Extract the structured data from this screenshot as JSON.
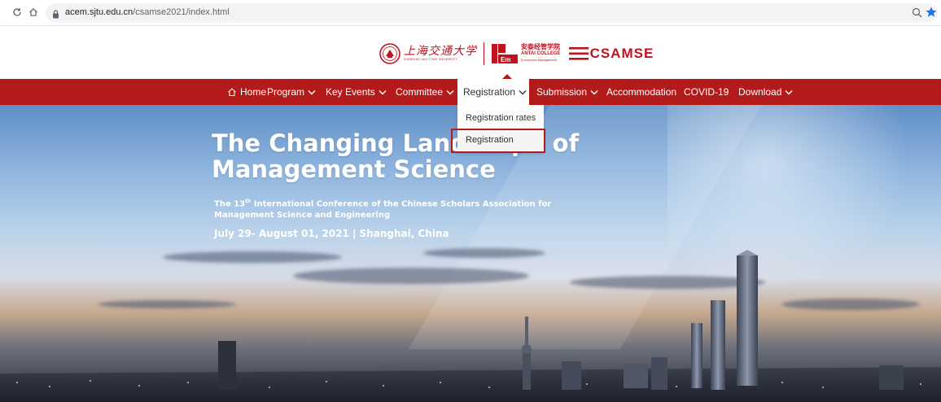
{
  "browser": {
    "url_domain": "acem.sjtu.edu.cn",
    "url_path": "/csamse2021/index.html",
    "icons": [
      "reload-icon",
      "home-icon",
      "lock-icon",
      "zoom-icon",
      "bookmark-star-icon"
    ]
  },
  "header": {
    "sjtu_name_cn": "上海交通大学",
    "sjtu_name_en": "SHANGHAI JIAO TONG UNIVERSITY",
    "acem_name_cn": "安泰经管学院",
    "acem_name_en": "ANTAI COLLEGE",
    "acem_subtitle": "Economics Management",
    "csamse_logo_text": "CSAMSE"
  },
  "nav": {
    "items": [
      {
        "label": "Home",
        "has_dropdown": false
      },
      {
        "label": "Program",
        "has_dropdown": true
      },
      {
        "label": "Key Events",
        "has_dropdown": true
      },
      {
        "label": "Committee",
        "has_dropdown": true
      },
      {
        "label": "Registration",
        "has_dropdown": true,
        "active": true
      },
      {
        "label": "Submission",
        "has_dropdown": true
      },
      {
        "label": "Accommodation",
        "has_dropdown": false
      },
      {
        "label": "COVID-19",
        "has_dropdown": false
      },
      {
        "label": "Download",
        "has_dropdown": true
      }
    ],
    "dropdown": {
      "items": [
        {
          "label": "Registration rates"
        },
        {
          "label": "Registration",
          "highlighted": true
        }
      ]
    }
  },
  "hero": {
    "title": "The Changing Landscape of Management Science",
    "subtitle_prefix": "The 13",
    "subtitle_sup": "th",
    "subtitle_rest": " International Conference of the Chinese Scholars Association for Management Science and Engineering",
    "date_line": "July 29- August 01, 2021 | Shanghai, China"
  },
  "colors": {
    "brand_red": "#b31b1b",
    "logo_red": "#c1121f",
    "highlight_border": "#b31b1b"
  }
}
